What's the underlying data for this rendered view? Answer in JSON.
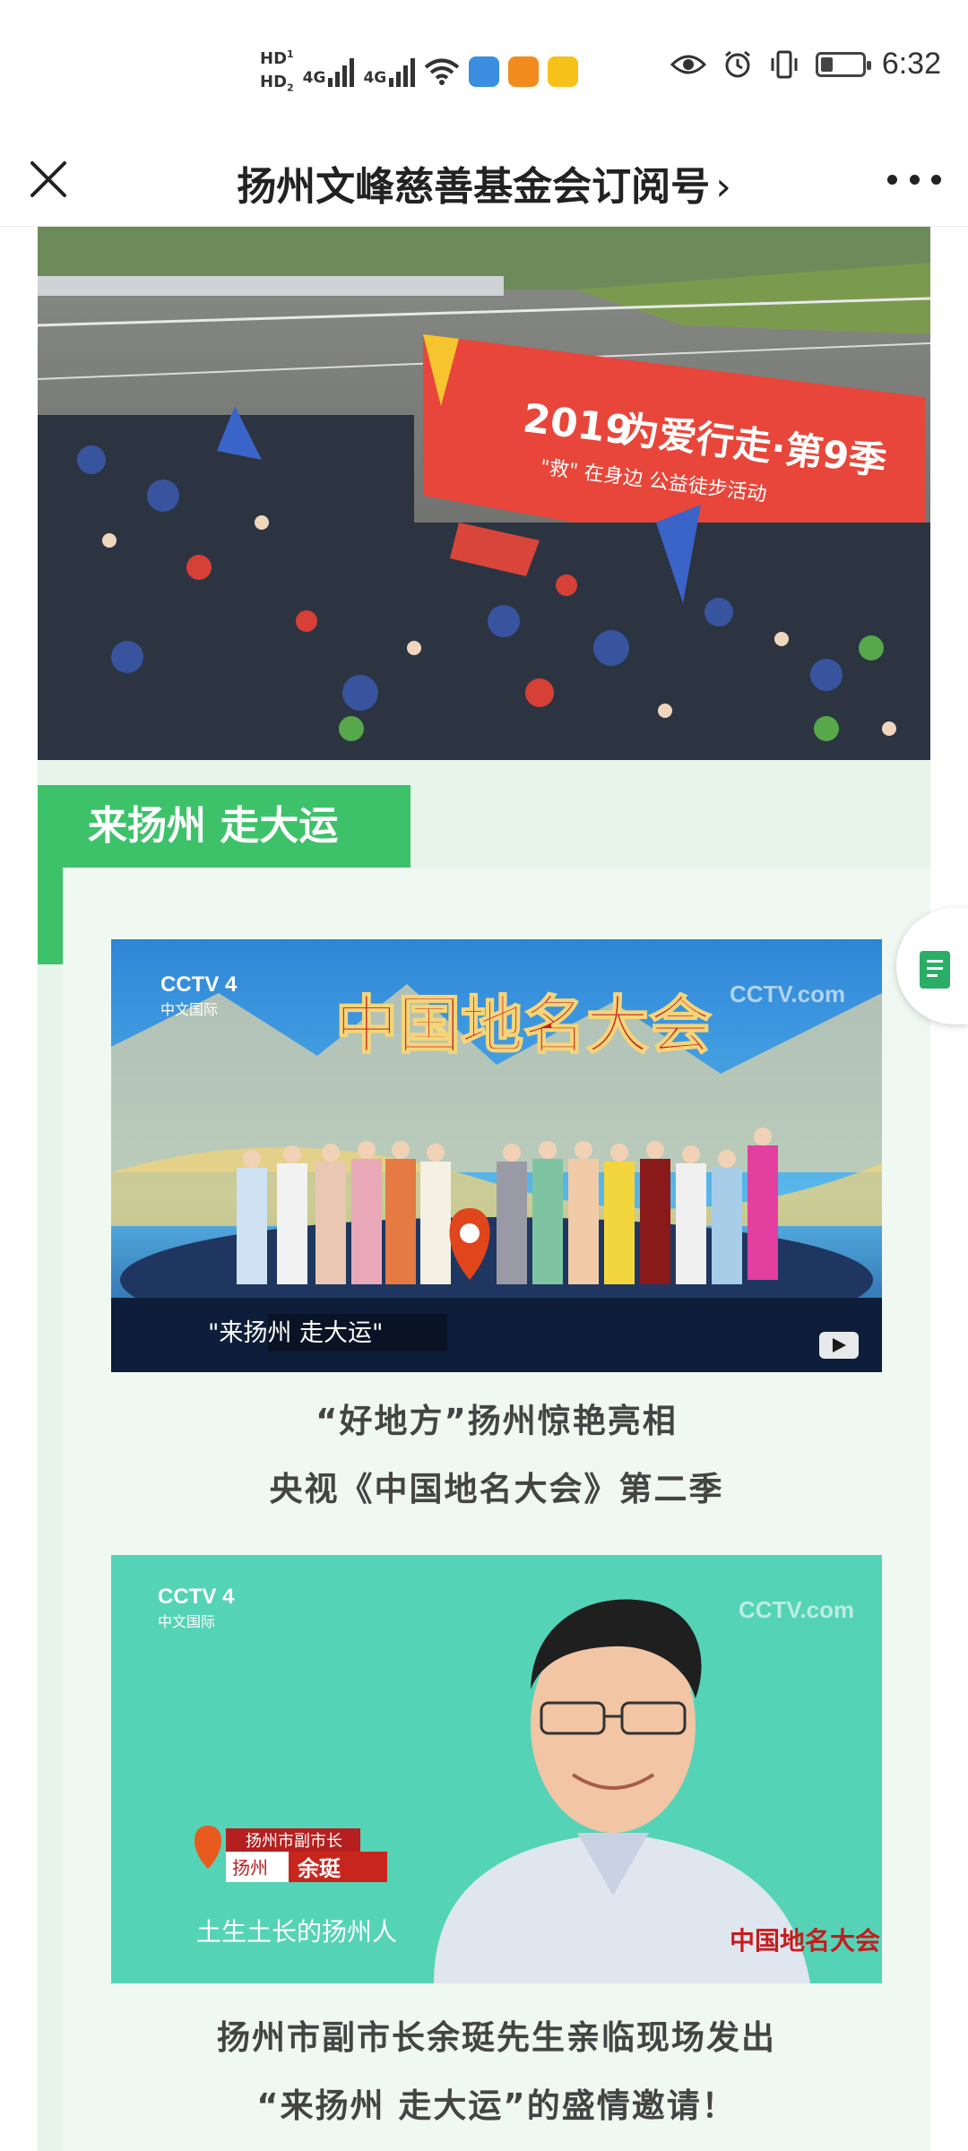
{
  "status_bar": {
    "hd1": "HD",
    "hd2": "HD",
    "hd1_sub": "1",
    "hd2_sub": "2",
    "net1": "4G",
    "net2": "4G",
    "time": "6:32",
    "battery_level": 0.3
  },
  "nav": {
    "title": "扬州文峰慈善基金会订阅号",
    "chevron": "›"
  },
  "hero": {
    "banner_year": "2019",
    "banner_main": "为爱行走·第9季",
    "banner_sub": "\"救\" 在身边  公益徒步活动"
  },
  "section": {
    "title": "来扬州 走大运"
  },
  "video1": {
    "channel": "CCTV 4",
    "channel_sub": "中文国际",
    "watermark": "CCTV.com",
    "show_title": "中国地名大会",
    "subtitle_overlay": "\"来扬州  走大运\""
  },
  "caption1": {
    "line1": "“好地方”扬州惊艳亮相",
    "line2": "央视《中国地名大会》第二季"
  },
  "video2": {
    "channel": "CCTV 4",
    "channel_sub": "中文国际",
    "watermark": "CCTV.com",
    "badge_role": "扬州市副市长",
    "badge_city": "扬州",
    "badge_name": "余珽",
    "subtitle_overlay": "土生土长的扬州人",
    "show_logo": "中国地名大会"
  },
  "caption2": {
    "line1": "扬州市副市长余珽先生亲临现场发出",
    "line2": "“来扬州 走大运”的盛情邀请！"
  },
  "colors": {
    "accent_green": "#3dc26a",
    "panel_green": "#e6f4ea",
    "banner_red": "#e8463a"
  }
}
